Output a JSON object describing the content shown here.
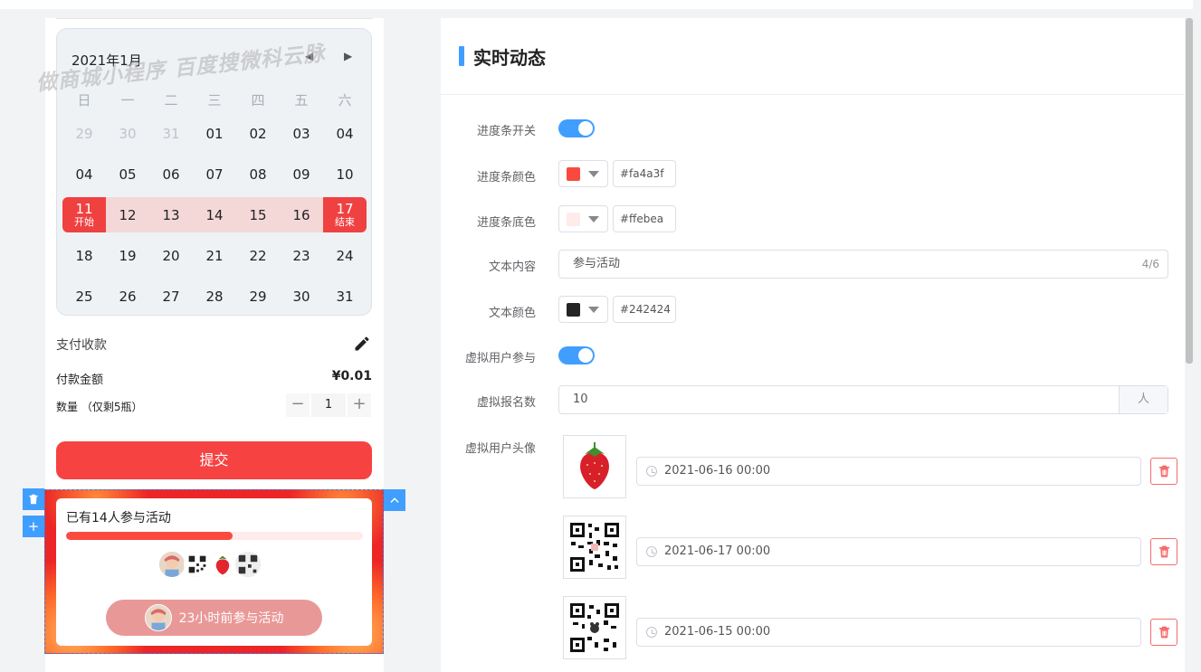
{
  "calendar": {
    "title": "2021年1月",
    "prev_icon": "◀",
    "next_icon": "▶",
    "watermark": "做商城小程序 百度搜微科云脉",
    "weekdays": [
      "日",
      "一",
      "二",
      "三",
      "四",
      "五",
      "六"
    ],
    "rows": [
      [
        {
          "d": "29",
          "muted": true
        },
        {
          "d": "30",
          "muted": true
        },
        {
          "d": "31",
          "muted": true
        },
        {
          "d": "01"
        },
        {
          "d": "02"
        },
        {
          "d": "03"
        },
        {
          "d": "04"
        }
      ],
      [
        {
          "d": "04"
        },
        {
          "d": "05"
        },
        {
          "d": "06"
        },
        {
          "d": "07"
        },
        {
          "d": "08"
        },
        {
          "d": "09"
        },
        {
          "d": "10"
        }
      ],
      [
        {
          "d": "11",
          "sel": "start",
          "tag": "开始"
        },
        {
          "d": "12"
        },
        {
          "d": "13"
        },
        {
          "d": "14"
        },
        {
          "d": "15"
        },
        {
          "d": "16"
        },
        {
          "d": "17",
          "sel": "end",
          "tag": "结束"
        }
      ],
      [
        {
          "d": "18"
        },
        {
          "d": "19"
        },
        {
          "d": "20"
        },
        {
          "d": "21"
        },
        {
          "d": "22"
        },
        {
          "d": "23"
        },
        {
          "d": "24"
        }
      ],
      [
        {
          "d": "25"
        },
        {
          "d": "26"
        },
        {
          "d": "27"
        },
        {
          "d": "28"
        },
        {
          "d": "29"
        },
        {
          "d": "30"
        },
        {
          "d": "31"
        }
      ]
    ],
    "range_row": 2
  },
  "payment": {
    "title": "支付收款",
    "amount_label": "付款金额",
    "amount_value": "¥0.01",
    "qty_label": "数量 （仅剩5瓶）",
    "qty_minus": "−",
    "qty_value": "1",
    "qty_plus": "+",
    "submit": "提交"
  },
  "module": {
    "title": "已有14人参与活动",
    "progress": 0.56,
    "pill_text": "23小时前参与活动",
    "delete_icon": "🗑",
    "add_icon": "+",
    "up_icon": "︿"
  },
  "panel": {
    "title": "实时动态",
    "progress_switch_label": "进度条开关",
    "progress_color_label": "进度条颜色",
    "progress_color": "#fa4a3f",
    "progress_bg_label": "进度条底色",
    "progress_bg": "#ffebea",
    "text_label": "文本内容",
    "text_value": "参与活动",
    "text_count": "4/6",
    "text_color_label": "文本颜色",
    "text_color": "#242424",
    "virtual_switch_label": "虚拟用户参与",
    "virtual_count_label": "虚拟报名数",
    "virtual_count": "10",
    "virtual_count_unit": "人",
    "virtual_avatar_label": "虚拟用户头像",
    "avatars": [
      {
        "kind": "strawberry",
        "date": "2021-06-16 00:00"
      },
      {
        "kind": "qr",
        "date": "2021-06-17 00:00"
      },
      {
        "kind": "qr2",
        "date": "2021-06-15 00:00"
      }
    ]
  },
  "colors": {
    "accent": "#409eff",
    "danger": "#f74242",
    "progress_fill": "#fa4a3f",
    "progress_track": "#ffebea",
    "text": "#242424"
  }
}
